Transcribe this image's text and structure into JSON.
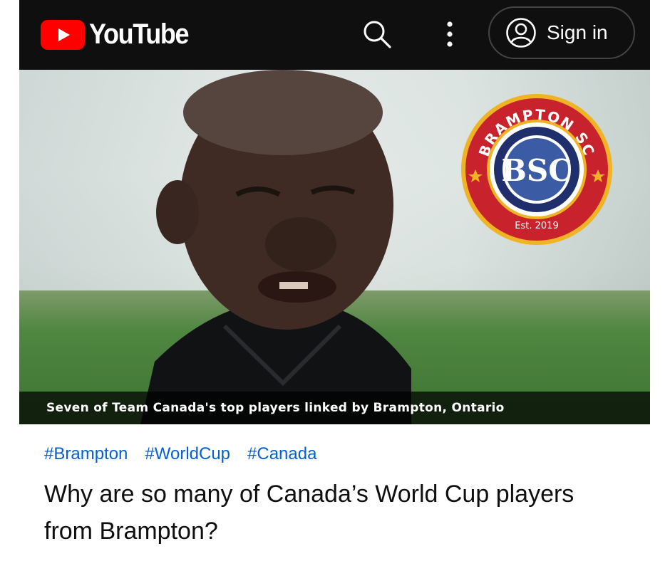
{
  "header": {
    "brand": "YouTube",
    "search_icon": "search-icon",
    "more_icon": "more-vertical-icon",
    "signin_label": "Sign in",
    "signin_icon": "account-circle-icon"
  },
  "video": {
    "caption": "Seven of Team Canada's top players linked by Brampton, Ontario",
    "overlay_logo": {
      "top_text": "BRAMPTON SC",
      "monogram": "BSC",
      "bottom_text": "Est. 2019"
    }
  },
  "tags": [
    "#Brampton",
    "#WorldCup",
    "#Canada"
  ],
  "title": "Why are so many of Canada’s World Cup players from Brampton?",
  "colors": {
    "brand_red": "#ff0000",
    "topbar": "#0f0f0f",
    "tag_link": "#065fd4",
    "badge_red": "#c8232c",
    "badge_navy": "#1f2f6b",
    "badge_gold": "#f0b323"
  }
}
